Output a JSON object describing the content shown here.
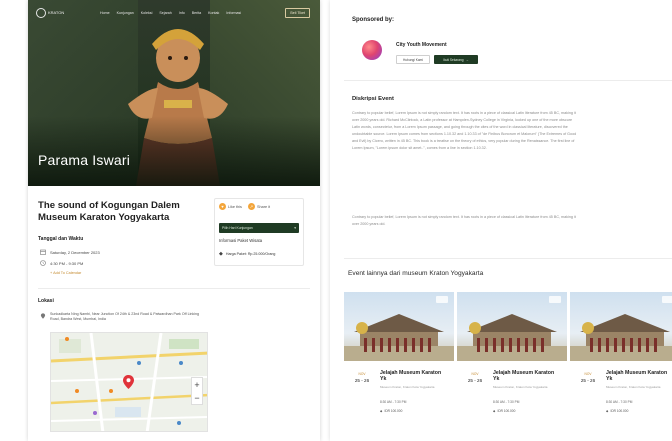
{
  "nav": {
    "logo_text": "KRATON",
    "links": [
      "Home",
      "Kunjungan",
      "Koleksi",
      "Sejarah",
      "Info",
      "Berita",
      "Kontak",
      "Informasi"
    ],
    "cta": "Beli Tiket"
  },
  "hero": {
    "title": "Parama Iswari"
  },
  "event": {
    "title": "The sound of Kogungan Dalem Museum Karaton Yogyakarta",
    "date_time_label": "Tanggal dan Waktu",
    "date": "Saturday, 2 December 2023",
    "time": "4:30 PM - 9:30 PM",
    "add_calendar": "+ Add To Calendar",
    "location_label": "Lokasi",
    "address": "Sunkadkarta Ning Nambi, Near Junction Of 24th & 23nd Road & Patwardhan Park Off Linking Road, Bandra West, Mumbai, India"
  },
  "side": {
    "like": "Like this",
    "share": "Share it",
    "date_select": "Pilih Hari Kunjungan",
    "ticket_head": "Informasi Paket Wisata",
    "ticket_price": "Harga Paket: Rp.25.000/Orang"
  },
  "sponsor": {
    "title": "Sponsored by:",
    "org_name": "City Youth Movement",
    "btn_contact": "Hubungi Kami",
    "btn_follow": "Ikuti Sekarang"
  },
  "description": {
    "title": "Diskripsi Event",
    "p1": "Contrary to popular belief, Lorem Ipsum is not simply random text. It has roots in a piece of classical Latin literature from 45 BC, making it over 2000 years old. Richard McClintock, a Latin professor at Hampden-Sydney College in Virginia, looked up one of the more obscure Latin words, consectetur, from a Lorem Ipsum passage, and going through the cites of the word in classical literature, discovered the undoubtable source. Lorem Ipsum comes from sections 1.10.32 and 1.10.33 of \"de Finibus Bonorum et Malorum\" (The Extremes of Good and Evil) by Cicero, written in 45 BC. This book is a treatise on the theory of ethics, very popular during the Renaissance. The first line of Lorem Ipsum, \"Lorem ipsum dolor sit amet..\", comes from a line in section 1.10.32.",
    "p2": "Contrary to popular belief, Lorem Ipsum is not simply random text. It has roots in a piece of classical Latin literature from 45 BC, making it over 2000 years old."
  },
  "more": {
    "title": "Event lainnya dari museum Kraton Yogyakarta",
    "cards": [
      {
        "month": "NOV",
        "days": "25 - 26",
        "title": "Jelajah Museum Karaton Yk",
        "location": "Museum Kraton, Kraton Kota Yogyakarta",
        "time": "8:30 AM - 7:30 PM",
        "price": "IDR 100.000"
      },
      {
        "month": "NOV",
        "days": "25 - 26",
        "title": "Jelajah Museum Karaton Yk",
        "location": "Museum Kraton, Kraton Kota Yogyakarta",
        "time": "8:30 AM - 7:30 PM",
        "price": "IDR 100.000"
      },
      {
        "month": "NOV",
        "days": "25 - 26",
        "title": "Jelajah Museum Karaton Yk",
        "location": "Museum Kraton, Kraton Kota Yogyakarta",
        "time": "8:30 AM - 7:30 PM",
        "price": "IDR 100.000"
      }
    ]
  },
  "colors": {
    "accent_green": "#1f3b24",
    "accent_gold": "#c48a2f",
    "map_pin": "#e0333a"
  }
}
